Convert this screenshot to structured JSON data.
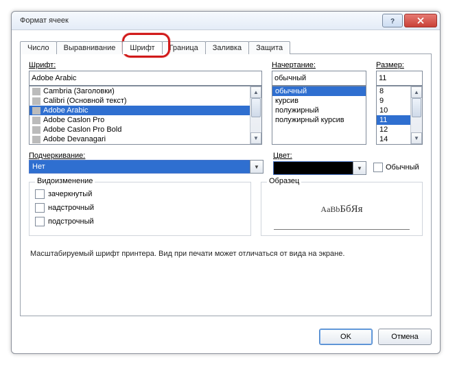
{
  "window": {
    "title": "Формат ячеек"
  },
  "tabs": [
    "Число",
    "Выравнивание",
    "Шрифт",
    "Граница",
    "Заливка",
    "Защита"
  ],
  "active_tab_index": 2,
  "font_section": {
    "label": "Шрифт:",
    "value": "Adobe Arabic",
    "items": [
      "Cambria (Заголовки)",
      "Calibri (Основной текст)",
      "Adobe Arabic",
      "Adobe Caslon Pro",
      "Adobe Caslon Pro Bold",
      "Adobe Devanagari"
    ],
    "selected_index": 2
  },
  "style_section": {
    "label": "Начертание:",
    "value": "обычный",
    "items": [
      "обычный",
      "курсив",
      "полужирный",
      "полужирный курсив"
    ],
    "selected_index": 0
  },
  "size_section": {
    "label": "Размер:",
    "value": "11",
    "items": [
      "8",
      "9",
      "10",
      "11",
      "12",
      "14"
    ],
    "selected_index": 3
  },
  "underline": {
    "label": "Подчеркивание:",
    "value": "Нет"
  },
  "color": {
    "label": "Цвет:",
    "swatch": "#000000"
  },
  "normal_font_checkbox": {
    "label": "Обычный",
    "checked": false
  },
  "effects": {
    "legend": "Видоизменение",
    "items": [
      {
        "label": "зачеркнутый",
        "checked": false
      },
      {
        "label": "надстрочный",
        "checked": false
      },
      {
        "label": "подстрочный",
        "checked": false
      }
    ]
  },
  "sample": {
    "legend": "Образец",
    "text_small": "AaBb",
    "text_big": "БбЯя"
  },
  "hint": "Масштабируемый шрифт принтера. Вид при печати может отличаться от вида на экране.",
  "buttons": {
    "ok": "OK",
    "cancel": "Отмена"
  }
}
